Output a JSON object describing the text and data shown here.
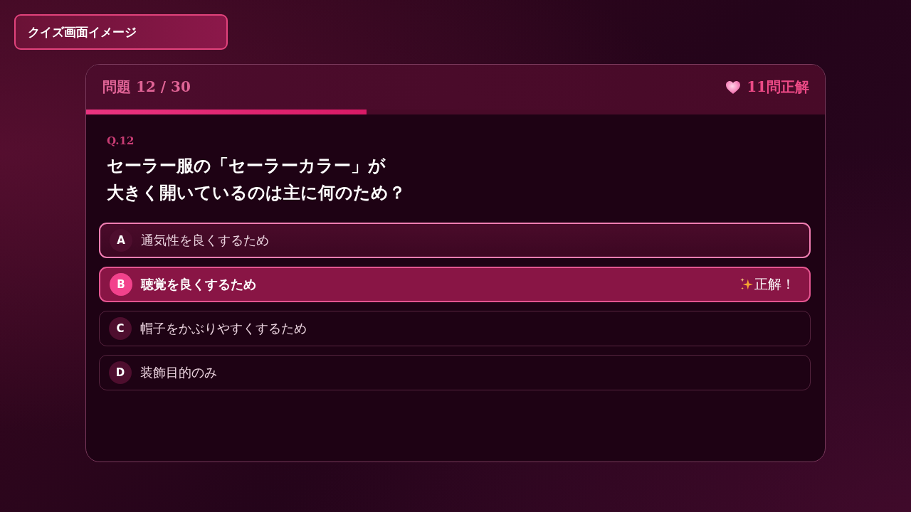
{
  "page_label": "クイズ画面イメージ",
  "quiz": {
    "progress_label": "問題 12 / 30",
    "score": "11問正解",
    "progress": {
      "level": 0.38
    },
    "question_number": "Q.12",
    "question_lines": [
      "セーラー服の「セーラーカラー」が",
      "大きく開いているのは主に何のため？"
    ],
    "options": [
      {
        "letter": "A",
        "text": "通気性を良くするため",
        "hovered": true,
        "selected": false
      },
      {
        "letter": "B",
        "text": "聴覚を良くするため",
        "hovered": false,
        "selected": true,
        "result": "正解！"
      },
      {
        "letter": "C",
        "text": "帽子をかぶりやすくするため",
        "hovered": false,
        "selected": false
      },
      {
        "letter": "D",
        "text": "装飾目的のみ",
        "hovered": false,
        "selected": false
      }
    ]
  }
}
